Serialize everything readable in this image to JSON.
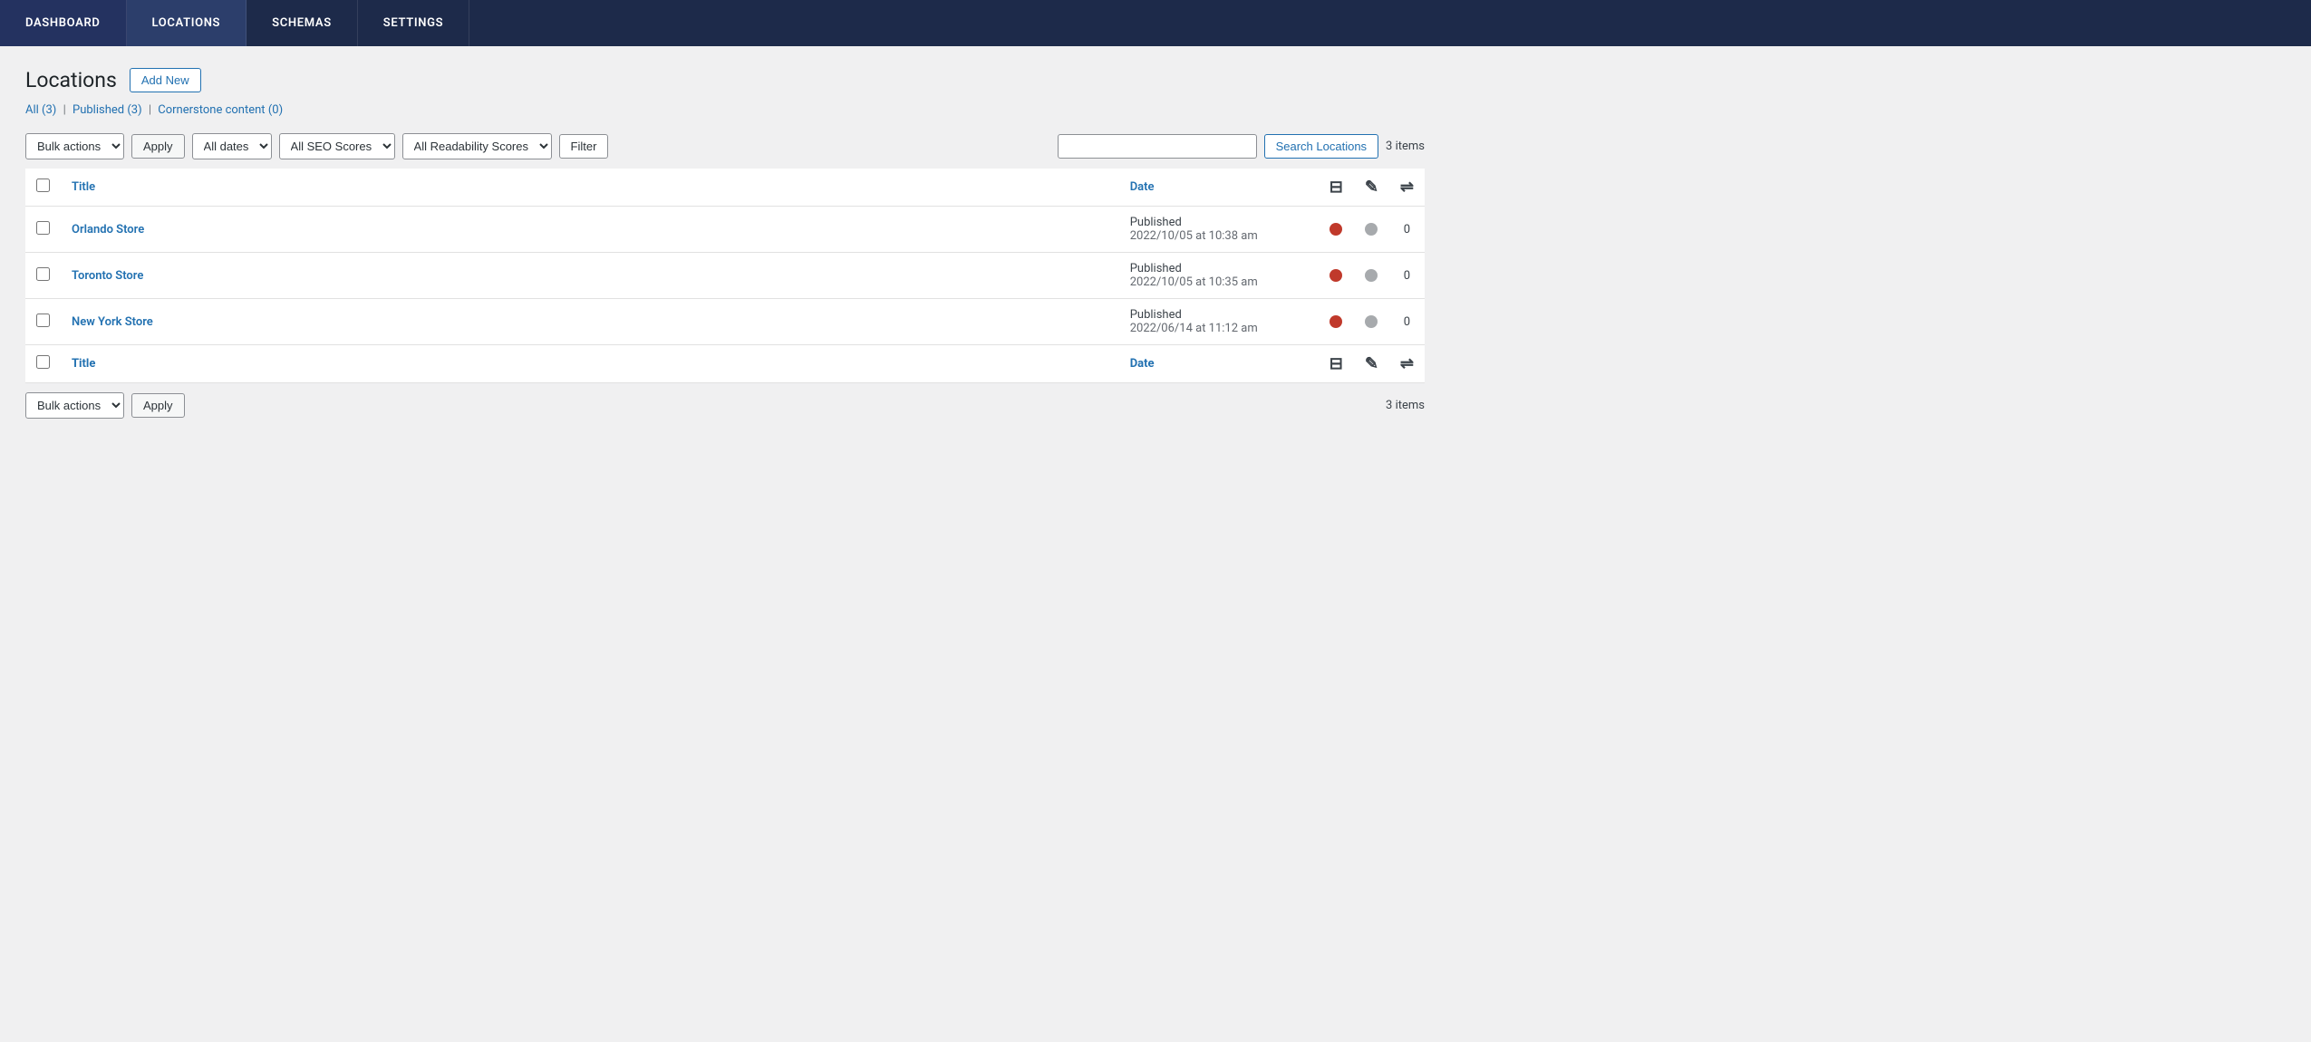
{
  "nav": {
    "items": [
      {
        "id": "dashboard",
        "label": "DASHBOARD",
        "active": false
      },
      {
        "id": "locations",
        "label": "LOCATIONS",
        "active": true
      },
      {
        "id": "schemas",
        "label": "SCHEMAS",
        "active": false
      },
      {
        "id": "settings",
        "label": "SETTINGS",
        "active": false
      }
    ]
  },
  "page": {
    "title": "Locations",
    "add_new_label": "Add New"
  },
  "filter_links": {
    "all": {
      "label": "All",
      "count": "(3)"
    },
    "published": {
      "label": "Published",
      "count": "(3)"
    },
    "cornerstone": {
      "label": "Cornerstone content",
      "count": "(0)"
    }
  },
  "toolbar_top": {
    "bulk_actions_label": "Bulk actions",
    "apply_label": "Apply",
    "all_dates_label": "All dates",
    "all_seo_label": "All SEO Scores",
    "all_readability_label": "All Readability Scores",
    "filter_label": "Filter",
    "items_count": "3 items",
    "search_placeholder": "",
    "search_button_label": "Search Locations"
  },
  "table": {
    "col_title": "Title",
    "col_date": "Date",
    "rows": [
      {
        "id": "orlando",
        "title": "Orlando Store",
        "status_label": "Published",
        "date": "2022/10/05 at 10:38 am",
        "seo_dot": "red",
        "readability_dot": "gray",
        "count": "0"
      },
      {
        "id": "toronto",
        "title": "Toronto Store",
        "status_label": "Published",
        "date": "2022/10/05 at 10:35 am",
        "seo_dot": "red",
        "readability_dot": "gray",
        "count": "0"
      },
      {
        "id": "new-york",
        "title": "New York Store",
        "status_label": "Published",
        "date": "2022/06/14 at 11:12 am",
        "seo_dot": "red",
        "readability_dot": "gray",
        "count": "0"
      }
    ]
  },
  "toolbar_bottom": {
    "bulk_actions_label": "Bulk actions",
    "apply_label": "Apply",
    "items_count": "3 items"
  }
}
